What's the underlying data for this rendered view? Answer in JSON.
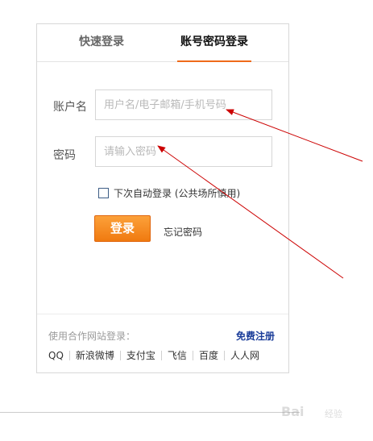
{
  "tabs": {
    "quick_login": "快速登录",
    "account_login": "账号密码登录"
  },
  "form": {
    "username_label": "账户名",
    "username_placeholder": "用户名/电子邮箱/手机号码",
    "password_label": "密码",
    "password_placeholder": "请输入密码",
    "remember_label": "下次自动登录 (公共场所慎用)",
    "login_button": "登录",
    "forgot_password": "忘记密码"
  },
  "partner": {
    "hint": "使用合作网站登录：",
    "register": "免费注册",
    "sites": [
      "QQ",
      "新浪微博",
      "支付宝",
      "飞信",
      "百度",
      "人人网"
    ]
  },
  "watermark": {
    "text": "Bai",
    "sub": "经验"
  },
  "colors": {
    "accent": "#ef6a1a",
    "button": "#f58a1f",
    "link": "#1a3c99",
    "annotation_arrow": "#cc0000"
  }
}
